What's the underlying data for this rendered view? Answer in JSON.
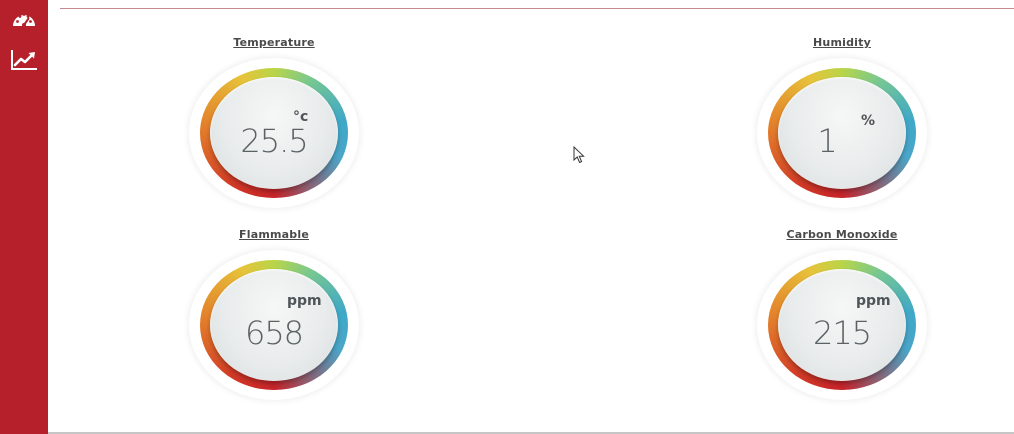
{
  "sidebar": {
    "items": [
      {
        "icon": "dashboard-icon"
      },
      {
        "icon": "trend-chart-icon"
      }
    ]
  },
  "sensors": {
    "temperature": {
      "title": "Temperature",
      "value": "25.5",
      "unit": "°c"
    },
    "humidity": {
      "title": "Humidity",
      "value": "1",
      "unit": "%"
    },
    "flammable": {
      "title": "Flammable",
      "value": "658",
      "unit": "ppm"
    },
    "carbon_monoxide": {
      "title": "Carbon Monoxide",
      "value": "215",
      "unit": "ppm"
    }
  },
  "colors": {
    "sidebar": "#b5202b",
    "gauge_red": "#c8242a",
    "gauge_yellow": "#e6c33a",
    "gauge_green": "#b9d548",
    "gauge_blue": "#3fa8c8"
  }
}
